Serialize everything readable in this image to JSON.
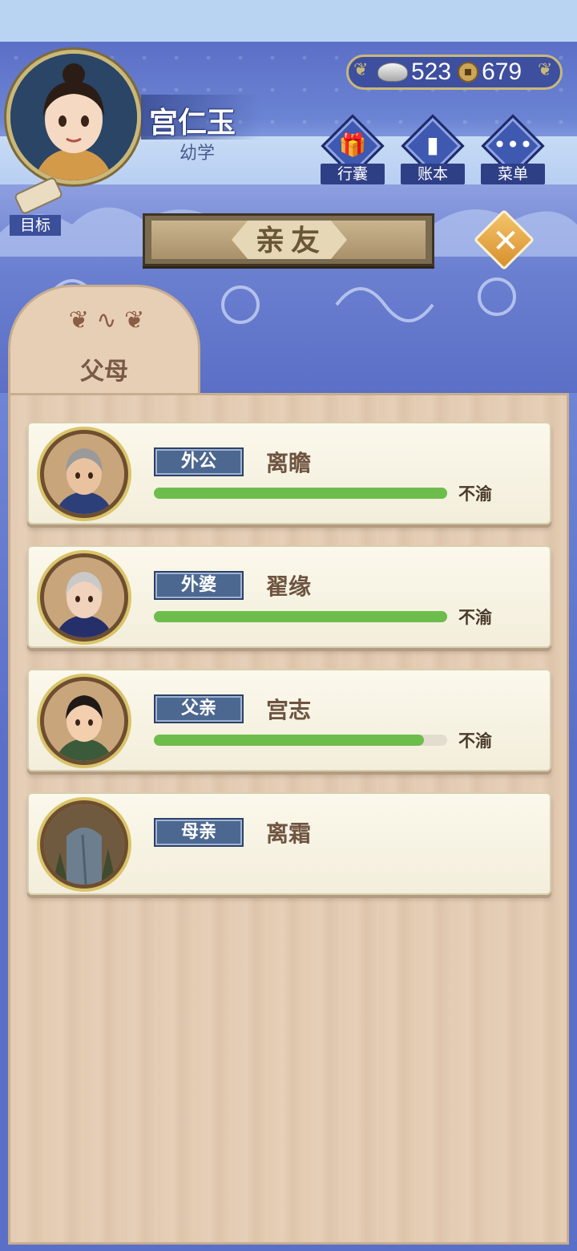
{
  "player": {
    "name": "宫仁玉",
    "stage": "幼学"
  },
  "currency": {
    "silver": "523",
    "copper": "679"
  },
  "menu": {
    "bag_label": "行囊",
    "ledger_label": "账本",
    "menu_label": "菜单",
    "goal_label": "目标"
  },
  "page": {
    "title": "亲友",
    "close_glyph": "✕"
  },
  "tab": {
    "label": "父母"
  },
  "relatives": [
    {
      "relation": "外公",
      "name": "离瞻",
      "mood": "不渝",
      "affinity": 1.0
    },
    {
      "relation": "外婆",
      "name": "翟缘",
      "mood": "不渝",
      "affinity": 1.0
    },
    {
      "relation": "父亲",
      "name": "宫志",
      "mood": "不渝",
      "affinity": 0.92
    },
    {
      "relation": "母亲",
      "name": "离霜",
      "mood": "",
      "affinity": null
    }
  ],
  "colors": {
    "affinity_bar": "#6dbd4c",
    "relation_tag": "#4d6890"
  }
}
